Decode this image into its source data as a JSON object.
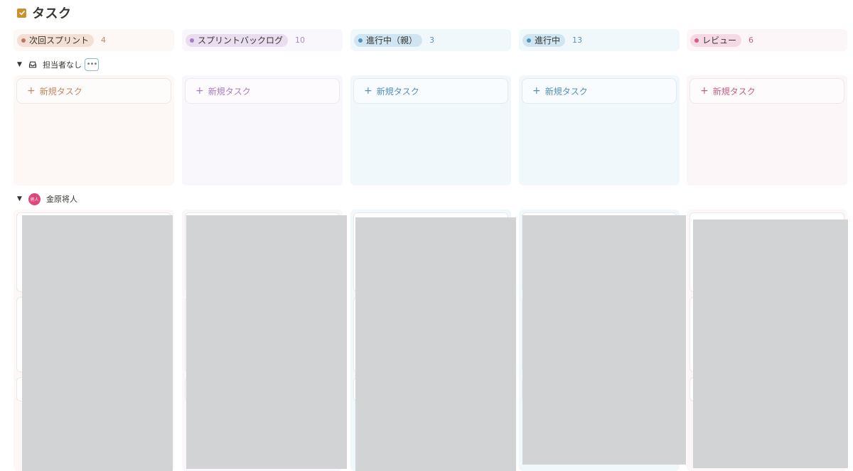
{
  "page": {
    "title": "タスク"
  },
  "columns": [
    {
      "label": "次回スプリント",
      "count": "4",
      "new_task": "新規タスク",
      "pill_bg": "#f3dfd3",
      "dot": "#b87a5c",
      "tint": "#fdf8f5",
      "count_color": "#c4855f",
      "accent": "#c4855f"
    },
    {
      "label": "スプリントバックログ",
      "count": "10",
      "new_task": "新規タスク",
      "pill_bg": "#e8def0",
      "dot": "#a77ec4",
      "tint": "#faf7fc",
      "count_color": "#a889c2",
      "accent": "#a57cc1"
    },
    {
      "label": "進行中（親）",
      "count": "3",
      "new_task": "新規タスク",
      "pill_bg": "#cfe5f2",
      "dot": "#4f93c1",
      "tint": "#f1f8fc",
      "count_color": "#5f91b5",
      "accent": "#4f8fba"
    },
    {
      "label": "進行中",
      "count": "13",
      "new_task": "新規タスク",
      "pill_bg": "#cfe5f2",
      "dot": "#4f93c1",
      "tint": "#f1f8fc",
      "count_color": "#5f91b5",
      "accent": "#4f8fba"
    },
    {
      "label": "レビュー",
      "count": "6",
      "new_task": "新規タスク",
      "pill_bg": "#f6d9e4",
      "dot": "#d45b8a",
      "tint": "#fdf6f8",
      "count_color": "#c45d86",
      "accent": "#c45d86"
    }
  ],
  "groups": [
    {
      "label": "担当者なし",
      "icon": "inbox-icon"
    },
    {
      "label": "金原将人",
      "avatar_text": "将人"
    }
  ]
}
